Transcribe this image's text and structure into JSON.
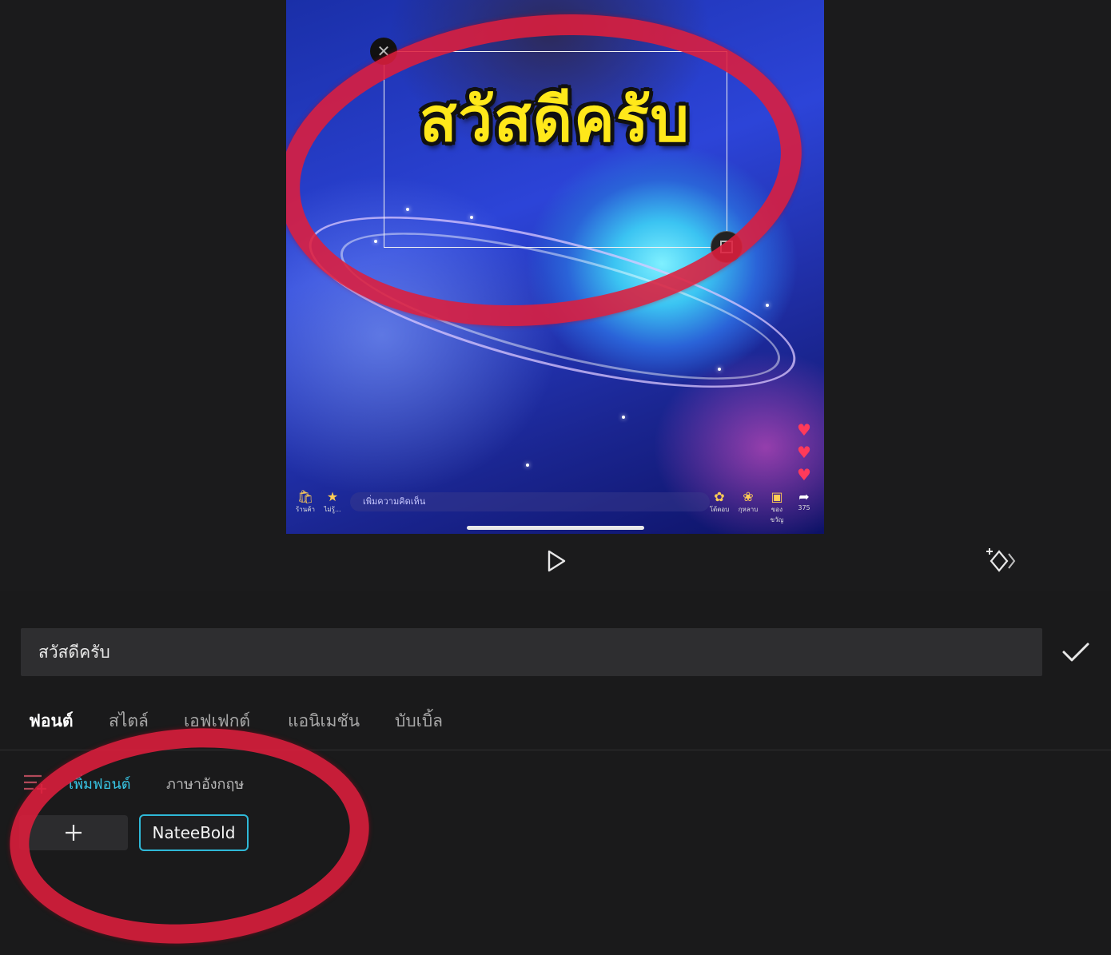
{
  "video": {
    "overlay_text": "สวัสดีครับ",
    "comment_placeholder": "เพิ่มความคิดเห็น",
    "share_count": "375",
    "bottom_labels": [
      "ร้านค้า",
      "ไม่รู้...",
      "โต้ตอบ",
      "กุหลาบ",
      "ของขวัญ"
    ]
  },
  "editor": {
    "text_value": "สวัสดีครับ"
  },
  "tabs": [
    {
      "label": "ฟอนต์",
      "active": true
    },
    {
      "label": "สไตล์",
      "active": false
    },
    {
      "label": "เอฟเฟกต์",
      "active": false
    },
    {
      "label": "แอนิเมชัน",
      "active": false
    },
    {
      "label": "บับเบิ้ล",
      "active": false
    }
  ],
  "subtabs": [
    {
      "label": "เพิ่มฟอนต์",
      "active": true
    },
    {
      "label": "ภาษาอังกฤษ",
      "active": false
    }
  ],
  "fonts": {
    "selected": "NateeBold"
  },
  "colors": {
    "accent": "#2fb9d8",
    "annotation_red": "#de1e3c",
    "overlay_yellow": "#ffe81a"
  }
}
